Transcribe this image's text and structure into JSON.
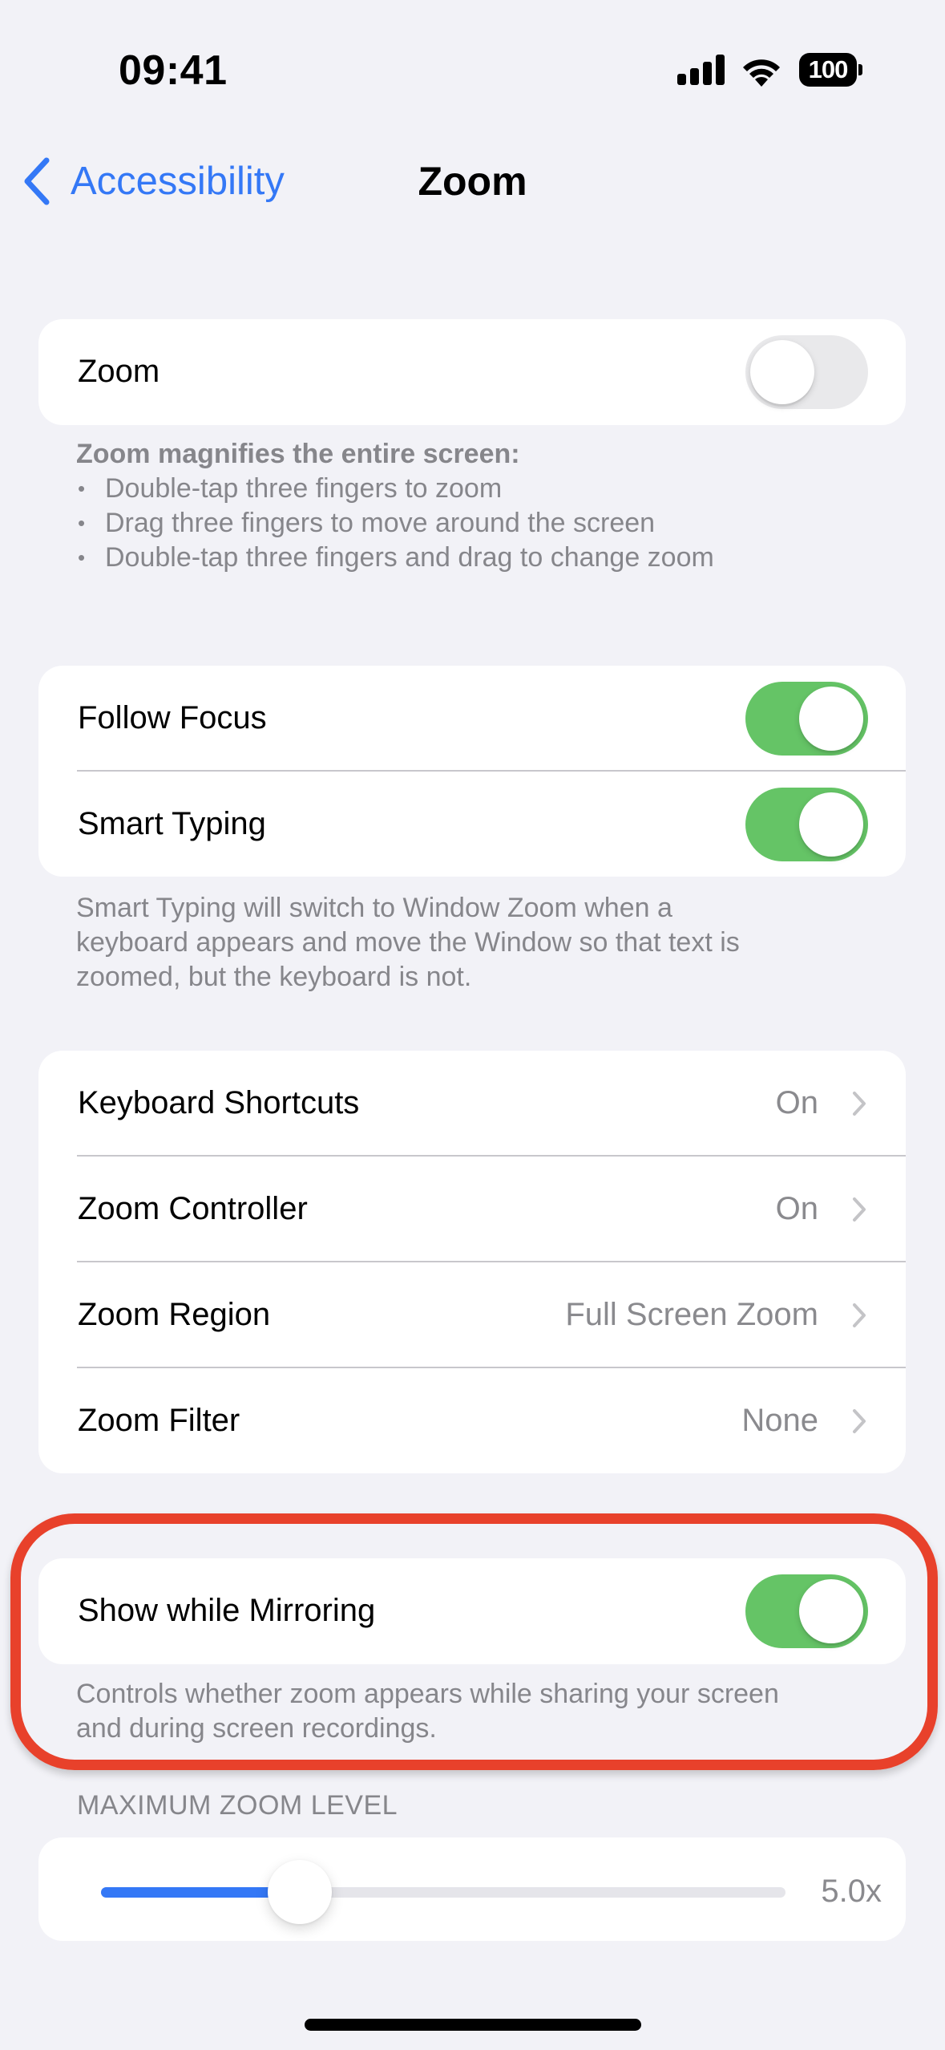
{
  "status_bar": {
    "time": "09:41",
    "battery": "100",
    "icons": [
      "cellular-signal-icon",
      "wifi-icon",
      "battery-icon"
    ]
  },
  "nav": {
    "back_label": "Accessibility",
    "title": "Zoom"
  },
  "zoom_toggle": {
    "label": "Zoom",
    "on": false
  },
  "zoom_footer": {
    "heading": "Zoom magnifies the entire screen:",
    "bullets": [
      "Double-tap three fingers to zoom",
      "Drag three fingers to move around the screen",
      "Double-tap three fingers and drag to change zoom"
    ]
  },
  "focus_group": {
    "rows": [
      {
        "label": "Follow Focus",
        "on": true
      },
      {
        "label": "Smart Typing",
        "on": true
      }
    ],
    "footer_lines": [
      "Smart Typing will switch to Window Zoom when a",
      "keyboard appears and move the Window so that text is",
      "zoomed, but the keyboard is not."
    ]
  },
  "nav_group": {
    "rows": [
      {
        "label": "Keyboard Shortcuts",
        "value": "On"
      },
      {
        "label": "Zoom Controller",
        "value": "On"
      },
      {
        "label": "Zoom Region",
        "value": "Full Screen Zoom"
      },
      {
        "label": "Zoom Filter",
        "value": "None"
      }
    ]
  },
  "mirroring": {
    "label": "Show while Mirroring",
    "on": true,
    "footer_lines": [
      "Controls whether zoom appears while sharing your screen",
      "and during screen recordings."
    ],
    "highlight_color": "#E8412B"
  },
  "max_zoom": {
    "header": "MAXIMUM ZOOM LEVEL",
    "value_label": "5.0x",
    "fraction": 0.29
  },
  "colors": {
    "accent": "#3478F6",
    "toggle_on": "#65C466",
    "background": "#F2F2F7",
    "secondary_text": "#86868B"
  }
}
